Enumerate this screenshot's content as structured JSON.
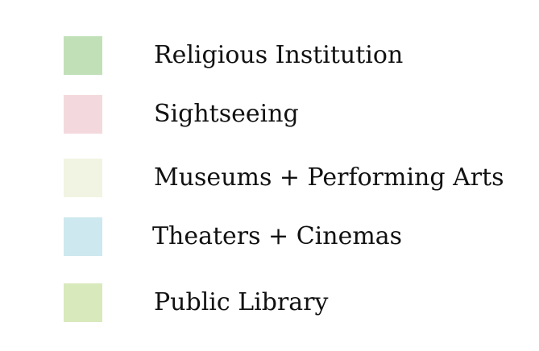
{
  "legend": {
    "items": [
      {
        "label": "Religious Institution",
        "color": "#c2e0b8"
      },
      {
        "label": "Sightseeing",
        "color": "#f3d9dd"
      },
      {
        "label": "Museums + Performing Arts",
        "color": "#f1f4e2"
      },
      {
        "label": "Theaters + Cinemas",
        "color": "#cde8ee"
      },
      {
        "label": "Public Library",
        "color": "#d8e9bb"
      }
    ]
  }
}
